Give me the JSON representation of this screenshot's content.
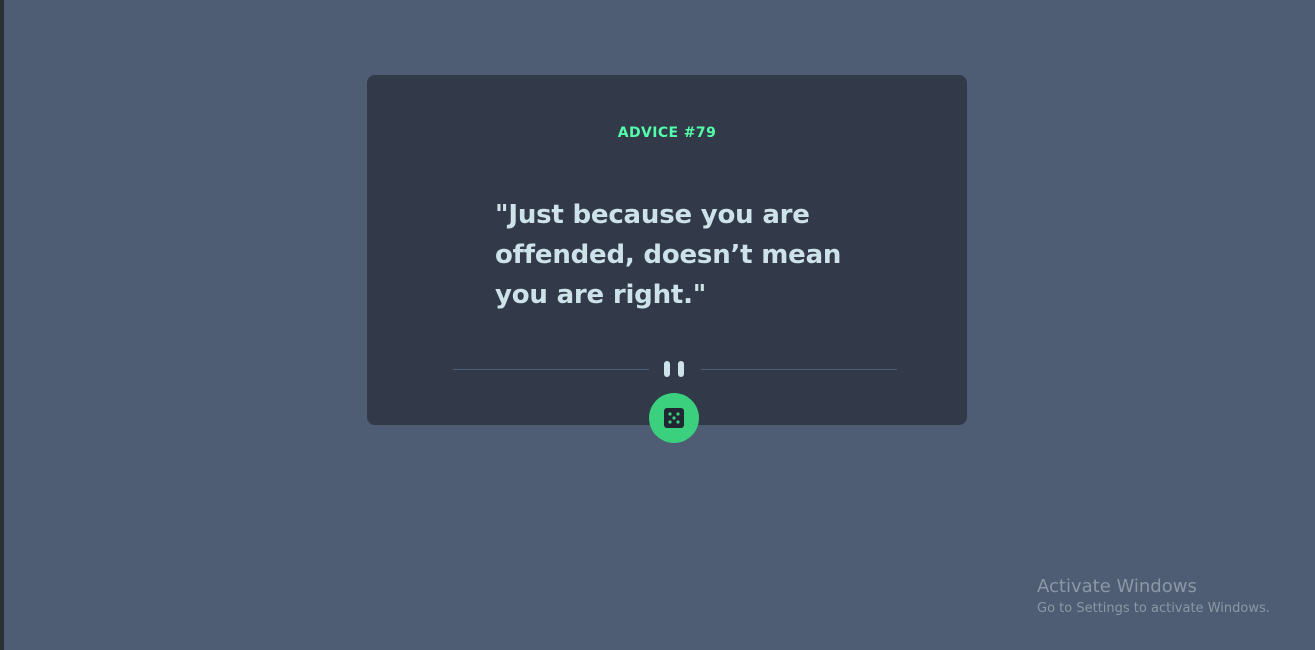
{
  "advice": {
    "id_label": "ADVICE #79",
    "text": "\"Just because you are offended, doesn’t mean you are right.\""
  },
  "icons": {
    "divider": "pause-icon",
    "button": "dice-icon"
  },
  "colors": {
    "background": "#4e5d73",
    "card": "#323a49",
    "accent": "#53ffab",
    "button": "#3bd07e",
    "text": "#cee3e9"
  },
  "watermark": {
    "title": "Activate Windows",
    "subtitle": "Go to Settings to activate Windows."
  }
}
